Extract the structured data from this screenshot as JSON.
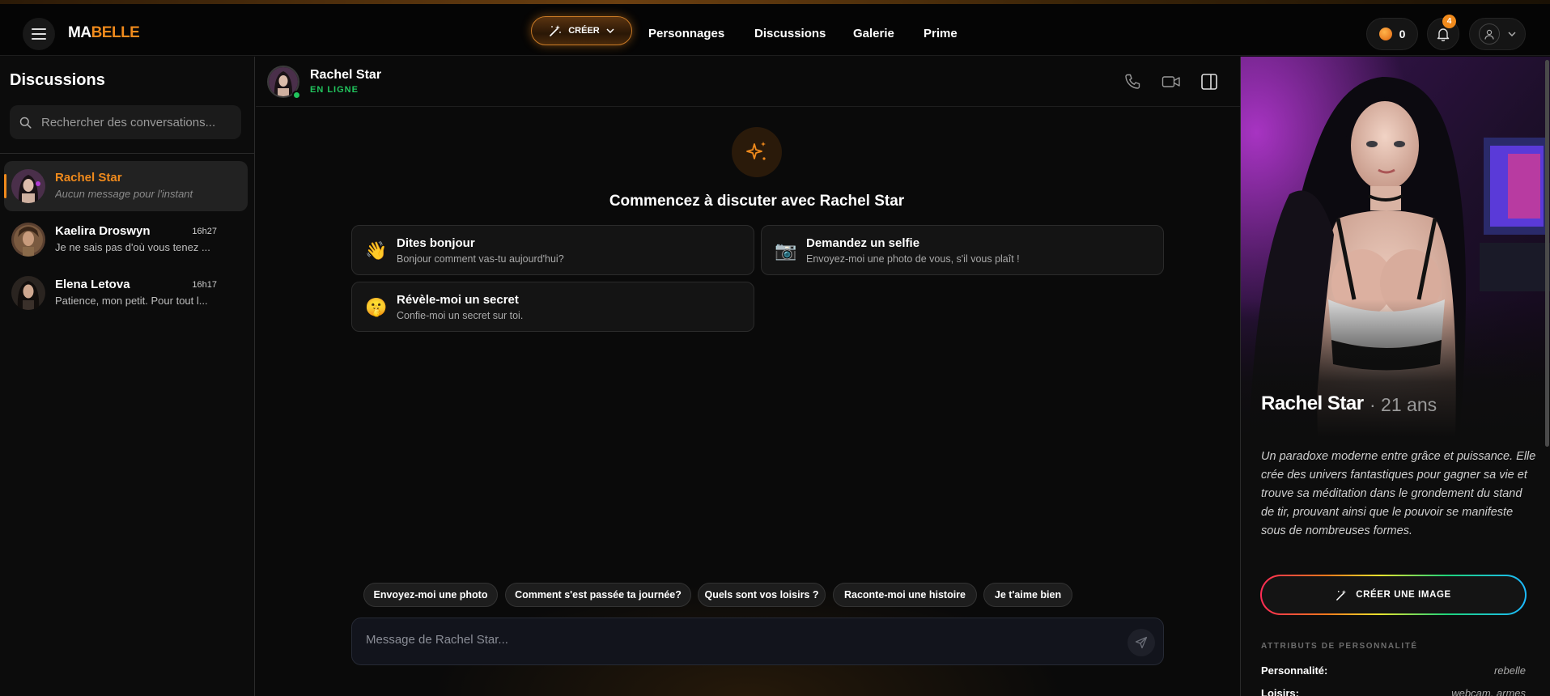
{
  "brand": {
    "logo_part1": "MA",
    "logo_part2": "BELLE"
  },
  "topnav": {
    "create_label": "CRÉER",
    "links": [
      "Personnages",
      "Discussions",
      "Galerie",
      "Prime"
    ],
    "coins": "0",
    "notifications": "4"
  },
  "sidebar": {
    "title": "Discussions",
    "search_placeholder": "Rechercher des conversations...",
    "conversations": [
      {
        "name": "Rachel Star",
        "preview": "Aucun message pour l'instant",
        "time": ""
      },
      {
        "name": "Kaelira Droswyn",
        "preview": "Je ne sais pas d'où vous tenez ...",
        "time": "16h27"
      },
      {
        "name": "Elena Letova",
        "preview": "Patience, mon petit. Pour tout l...",
        "time": "16h17"
      }
    ]
  },
  "chat": {
    "contact_name": "Rachel Star",
    "status": "EN LIGNE",
    "welcome": "Commencez à discuter avec Rachel Star",
    "starters": [
      {
        "icon": "👋",
        "title": "Dites bonjour",
        "subtitle": "Bonjour comment vas-tu aujourd'hui?"
      },
      {
        "icon": "📷",
        "title": "Demandez un selfie",
        "subtitle": "Envoyez-moi une photo de vous, s'il vous plaît !"
      },
      {
        "icon": "🤫",
        "title": "Révèle-moi un secret",
        "subtitle": "Confie-moi un secret sur toi."
      }
    ],
    "quick_replies": [
      "Envoyez-moi une photo",
      "Comment s'est passée ta journée?",
      "Quels sont vos loisirs ?",
      "Raconte-moi une histoire",
      "Je t'aime bien"
    ],
    "input_placeholder": "Message de Rachel Star..."
  },
  "profile": {
    "name": "Rachel Star",
    "age": "· 21 ans",
    "bio": "Un paradoxe moderne entre grâce et puissance. Elle crée des univers fantastiques pour gagner sa vie et trouve sa méditation dans le grondement du stand de tir, prouvant ainsi que le pouvoir se manifeste sous de nombreuses formes.",
    "create_image_label": "CRÉER UNE IMAGE",
    "attributes_title": "ATTRIBUTS DE PERSONNALITÉ",
    "attributes": [
      {
        "key": "Personnalité:",
        "value": "rebelle"
      },
      {
        "key": "Loisirs:",
        "value": "webcam, armes"
      }
    ]
  },
  "colors": {
    "accent": "#f08a1c",
    "online": "#21c45d",
    "background": "#0b0b0b"
  }
}
